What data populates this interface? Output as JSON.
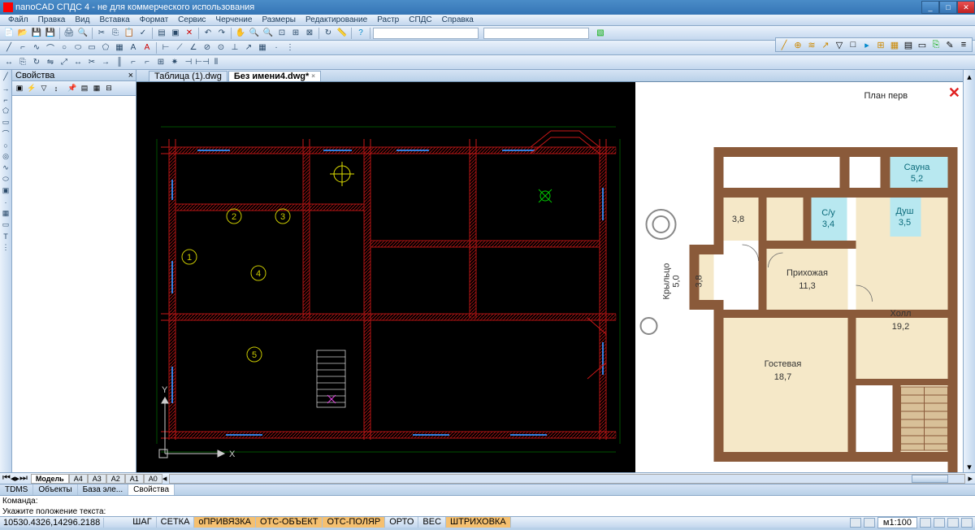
{
  "app": {
    "title": "nanoCAD СПДС 4 - не для коммерческого использования"
  },
  "menu": [
    "Файл",
    "Правка",
    "Вид",
    "Вставка",
    "Формат",
    "Сервис",
    "Черчение",
    "Размеры",
    "Редактирование",
    "Растр",
    "СПДС",
    "Справка"
  ],
  "tabs": {
    "inactive": "Таблица (1).dwg",
    "active": "Без имени4.dwg*"
  },
  "properties_panel": {
    "title": "Свойства"
  },
  "model_tabs": {
    "active": "Модель",
    "layouts": [
      "A4",
      "A3",
      "A2",
      "A1",
      "A0"
    ]
  },
  "lower_tabs": [
    "TDMS",
    "Объекты",
    "База эле...",
    "Свойства"
  ],
  "command": {
    "line1": "Команда:",
    "line2": "Укажите положение текста:"
  },
  "status": {
    "coords": "10530.4326,14296.2188",
    "buttons": [
      "ШАГ",
      "СЕТКА",
      "оПРИВЯЗКА",
      "ОТС-ОБЪЕКТ",
      "ОТС-ПОЛЯР",
      "ОРТО",
      "ВЕС",
      "ШТРИХОВКА"
    ],
    "button_states": [
      false,
      false,
      true,
      true,
      true,
      false,
      false,
      true
    ],
    "scale": "м1:100"
  },
  "floorplan": {
    "title": "План перв",
    "rooms": [
      {
        "name": "Сауна",
        "area": "5,2"
      },
      {
        "name": "С/у",
        "area": "3,4"
      },
      {
        "name": "Душ",
        "area": "3,5"
      },
      {
        "name": "Прихожая",
        "area": "11,3"
      },
      {
        "name": "Холл",
        "area": "19,2"
      },
      {
        "name": "Гостевая",
        "area": "18,7"
      }
    ],
    "small_rooms": [
      "3,8",
      "3,8"
    ],
    "side_label": {
      "name": "Крыльцо",
      "area": "5,0"
    }
  },
  "cad": {
    "markers": [
      "1",
      "2",
      "3",
      "4",
      "5"
    ],
    "axes": {
      "x": "X",
      "y": "Y"
    }
  }
}
